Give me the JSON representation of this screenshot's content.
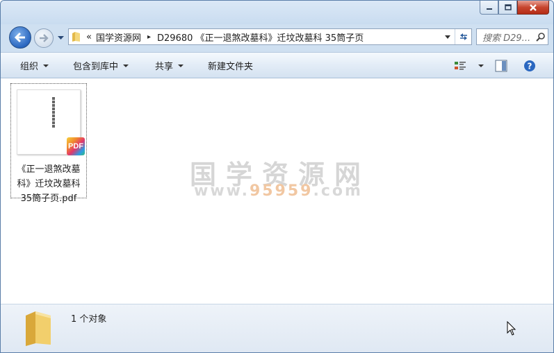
{
  "window": {
    "caption_buttons": [
      "minimize-icon",
      "maximize-icon",
      "close-icon"
    ]
  },
  "nav": {
    "back_icon": "back-arrow-icon",
    "forward_icon": "forward-arrow-icon"
  },
  "address": {
    "overflow": "«",
    "segments": [
      "国学资源网",
      "D29680 《正一退煞改墓科》迁坟改墓科 35筒子页"
    ],
    "separator": "▸"
  },
  "search": {
    "placeholder": "搜索 D29..."
  },
  "toolbar": {
    "organize_label": "组织",
    "include_library_label": "包含到库中",
    "share_label": "共享",
    "new_folder_label": "新建文件夹"
  },
  "files": [
    {
      "name": "《正一退煞改墓科》迁坟改墓科 35筒子页.pdf",
      "badge": "PDF",
      "type_icon": "pdf-icon"
    }
  ],
  "watermark": {
    "text": "国学资源网",
    "url_prefix": "www.",
    "url_highlight": "95959",
    "url_suffix": ".com"
  },
  "status": {
    "count_text": "1 个对象"
  },
  "colors": {
    "accent": "#2a67c0",
    "close": "#c7462f",
    "chrome": "#cfe0f1"
  }
}
